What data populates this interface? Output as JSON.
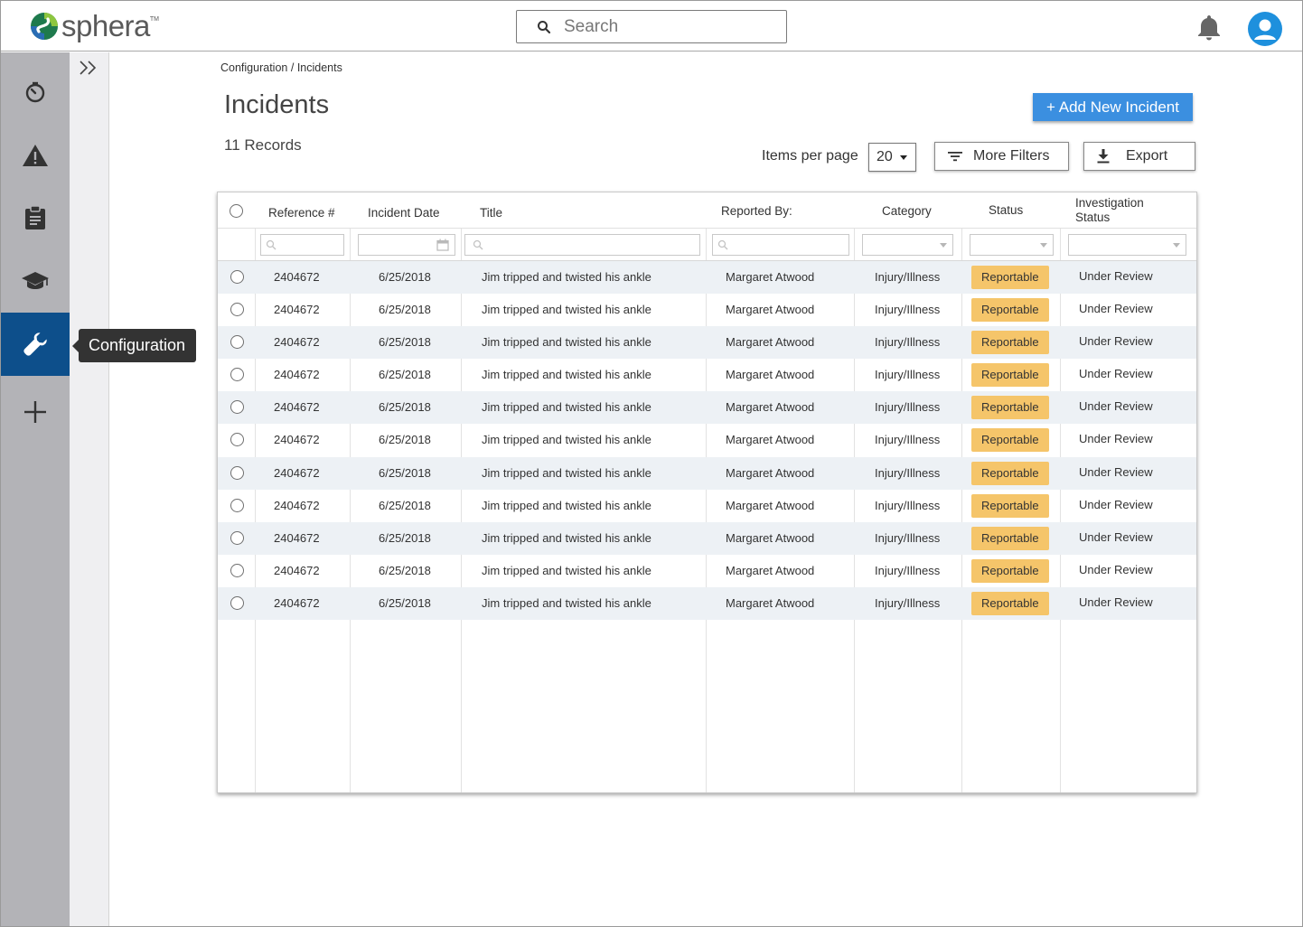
{
  "header": {
    "logo_text": "sphera",
    "logo_tm": "TM",
    "search_placeholder": "Search"
  },
  "rail": {
    "tooltip": "Configuration",
    "items": [
      {
        "icon": "timer-icon"
      },
      {
        "icon": "warning-icon"
      },
      {
        "icon": "clipboard-icon"
      },
      {
        "icon": "graduation-cap-icon"
      },
      {
        "icon": "wrench-icon",
        "active": true
      },
      {
        "icon": "plus-icon"
      }
    ]
  },
  "breadcrumb": {
    "parent": "Configuration",
    "separator": "/",
    "current": "Incidents"
  },
  "page": {
    "title": "Incidents",
    "records": "11 Records",
    "add_button": "+ Add New Incident",
    "items_per_page_label": "Items per page",
    "items_per_page_value": "20",
    "more_filters": "More Filters",
    "export": "Export"
  },
  "table": {
    "columns": {
      "reference": "Reference #",
      "date": "Incident Date",
      "title": "Title",
      "reported_by": "Reported By:",
      "category": "Category",
      "status": "Status",
      "investigation_line1": "Investigation",
      "investigation_line2": "Status"
    },
    "rows": [
      {
        "ref": "2404672",
        "date": "6/25/2018",
        "title": "Jim tripped and twisted his ankle",
        "reporter": "Margaret Atwood",
        "category": "Injury/Illness",
        "status": "Reportable",
        "investigation": "Under Review"
      },
      {
        "ref": "2404672",
        "date": "6/25/2018",
        "title": "Jim tripped and twisted his ankle",
        "reporter": "Margaret Atwood",
        "category": "Injury/Illness",
        "status": "Reportable",
        "investigation": "Under Review"
      },
      {
        "ref": "2404672",
        "date": "6/25/2018",
        "title": "Jim tripped and twisted his ankle",
        "reporter": "Margaret Atwood",
        "category": "Injury/Illness",
        "status": "Reportable",
        "investigation": "Under Review"
      },
      {
        "ref": "2404672",
        "date": "6/25/2018",
        "title": "Jim tripped and twisted his ankle",
        "reporter": "Margaret Atwood",
        "category": "Injury/Illness",
        "status": "Reportable",
        "investigation": "Under Review"
      },
      {
        "ref": "2404672",
        "date": "6/25/2018",
        "title": "Jim tripped and twisted his ankle",
        "reporter": "Margaret Atwood",
        "category": "Injury/Illness",
        "status": "Reportable",
        "investigation": "Under Review"
      },
      {
        "ref": "2404672",
        "date": "6/25/2018",
        "title": "Jim tripped and twisted his ankle",
        "reporter": "Margaret Atwood",
        "category": "Injury/Illness",
        "status": "Reportable",
        "investigation": "Under Review"
      },
      {
        "ref": "2404672",
        "date": "6/25/2018",
        "title": "Jim tripped and twisted his ankle",
        "reporter": "Margaret Atwood",
        "category": "Injury/Illness",
        "status": "Reportable",
        "investigation": "Under Review"
      },
      {
        "ref": "2404672",
        "date": "6/25/2018",
        "title": "Jim tripped and twisted his ankle",
        "reporter": "Margaret Atwood",
        "category": "Injury/Illness",
        "status": "Reportable",
        "investigation": "Under Review"
      },
      {
        "ref": "2404672",
        "date": "6/25/2018",
        "title": "Jim tripped and twisted his ankle",
        "reporter": "Margaret Atwood",
        "category": "Injury/Illness",
        "status": "Reportable",
        "investigation": "Under Review"
      },
      {
        "ref": "2404672",
        "date": "6/25/2018",
        "title": "Jim tripped and twisted his ankle",
        "reporter": "Margaret Atwood",
        "category": "Injury/Illness",
        "status": "Reportable",
        "investigation": "Under Review"
      },
      {
        "ref": "2404672",
        "date": "6/25/2018",
        "title": "Jim tripped and twisted his ankle",
        "reporter": "Margaret Atwood",
        "category": "Injury/Illness",
        "status": "Reportable",
        "investigation": "Under Review"
      }
    ]
  },
  "colors": {
    "accent": "#3b8fe0",
    "rail_active": "#0d4f8b",
    "badge": "#f5c56a",
    "row_alt": "#edf1f5"
  }
}
